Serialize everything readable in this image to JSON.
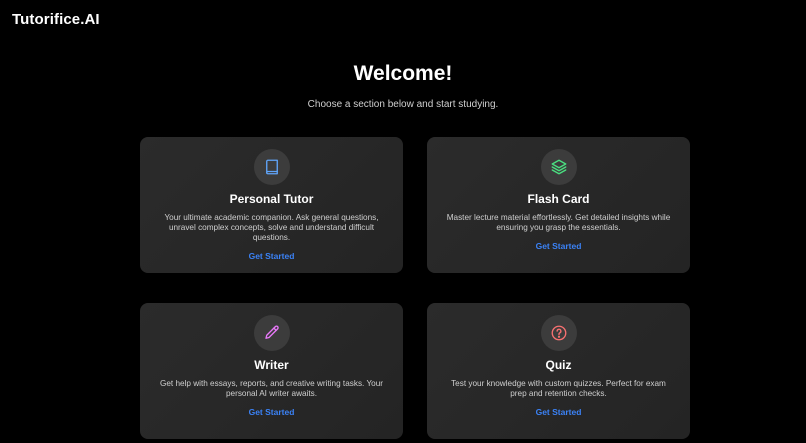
{
  "header": {
    "brand": "Tutorifice.AI"
  },
  "hero": {
    "title": "Welcome!",
    "subtitle": "Choose a section below and start studying."
  },
  "colors": {
    "accent": "#3b82f6",
    "book_icon": "#60a5fa",
    "layers_icon": "#4ade80",
    "pencil_icon": "#e879f9",
    "question_icon": "#f87171"
  },
  "cards": [
    {
      "icon": "book-icon",
      "title": "Personal Tutor",
      "description": "Your ultimate academic companion. Ask general questions, unravel complex concepts, solve and understand difficult questions.",
      "cta": "Get Started"
    },
    {
      "icon": "layers-icon",
      "title": "Flash Card",
      "description": "Master lecture material effortlessly. Get detailed insights while ensuring you grasp the essentials.",
      "cta": "Get Started"
    },
    {
      "icon": "pencil-icon",
      "title": "Writer",
      "description": "Get help with essays, reports, and creative writing tasks. Your personal AI writer awaits.",
      "cta": "Get Started"
    },
    {
      "icon": "question-icon",
      "title": "Quiz",
      "description": "Test your knowledge with custom quizzes. Perfect for exam prep and retention checks.",
      "cta": "Get Started"
    }
  ]
}
